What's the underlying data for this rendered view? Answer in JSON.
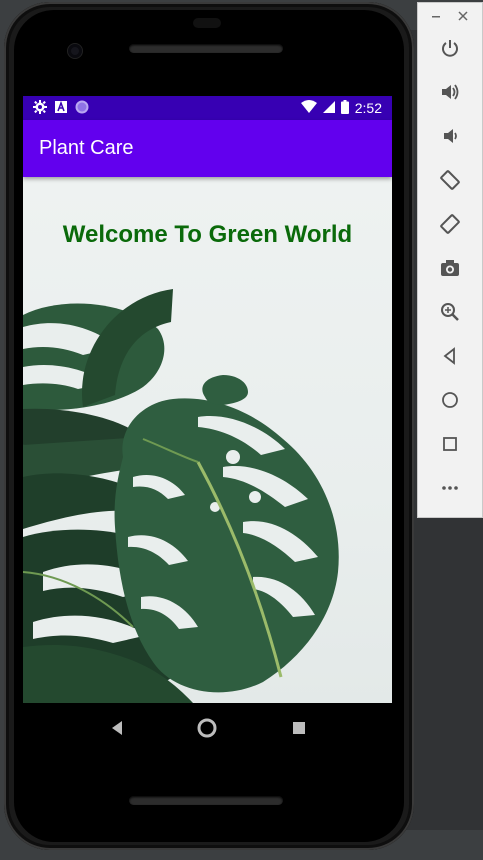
{
  "status_bar": {
    "time": "2:52",
    "left_icons": [
      "settings-gear-icon",
      "font-a-icon",
      "purple-circle-icon"
    ],
    "right_icons": [
      "wifi-icon",
      "cell-signal-icon",
      "battery-icon"
    ]
  },
  "app_bar": {
    "title": "Plant Care"
  },
  "content": {
    "welcome_text": "Welcome To Green World"
  },
  "nav_bar": {
    "buttons": [
      "back-triangle-icon",
      "home-circle-icon",
      "recents-square-icon"
    ]
  },
  "emulator_panel": {
    "window_controls": [
      "minimize",
      "close"
    ],
    "buttons": [
      "power",
      "volume-up",
      "volume-down",
      "rotate-left",
      "rotate-right",
      "screenshot",
      "zoom",
      "back",
      "home",
      "overview",
      "more"
    ]
  },
  "colors": {
    "status_bar": "#3700b3",
    "app_bar": "#6200ee",
    "welcome_text": "#0a6a0a",
    "leaf_dark": "#22452f",
    "leaf_mid": "#2f5e40"
  }
}
